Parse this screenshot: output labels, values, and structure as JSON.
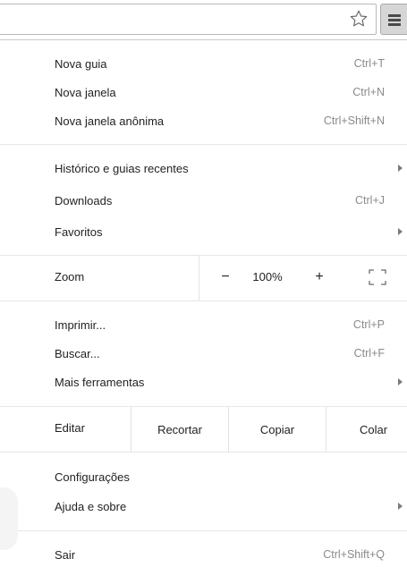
{
  "toolbar": {
    "star_icon": "star-outline-icon",
    "menu_icon": "hamburger-menu-icon"
  },
  "menu": {
    "group1": [
      {
        "label": "Nova guia",
        "shortcut": "Ctrl+T"
      },
      {
        "label": "Nova janela",
        "shortcut": "Ctrl+N"
      },
      {
        "label": "Nova janela anônima",
        "shortcut": "Ctrl+Shift+N"
      }
    ],
    "group2": [
      {
        "label": "Histórico e guias recentes",
        "shortcut": ""
      },
      {
        "label": "Downloads",
        "shortcut": "Ctrl+J"
      },
      {
        "label": "Favoritos",
        "shortcut": ""
      }
    ],
    "zoom": {
      "label": "Zoom",
      "minus": "−",
      "value": "100%",
      "plus": "+"
    },
    "group3": [
      {
        "label": "Imprimir...",
        "shortcut": "Ctrl+P"
      },
      {
        "label": "Buscar...",
        "shortcut": "Ctrl+F"
      },
      {
        "label": "Mais ferramentas",
        "shortcut": ""
      }
    ],
    "edit": {
      "label": "Editar",
      "cut": "Recortar",
      "copy": "Copiar",
      "paste": "Colar"
    },
    "group4": [
      {
        "label": "Configurações",
        "shortcut": ""
      },
      {
        "label": "Ajuda e sobre",
        "shortcut": ""
      }
    ],
    "exit": {
      "label": "Sair",
      "shortcut": "Ctrl+Shift+Q"
    }
  },
  "colors": {
    "menu_button_bg": "#d6d6d6",
    "shortcut_text": "#8a8a8a",
    "separator": "#e6e6e6"
  }
}
